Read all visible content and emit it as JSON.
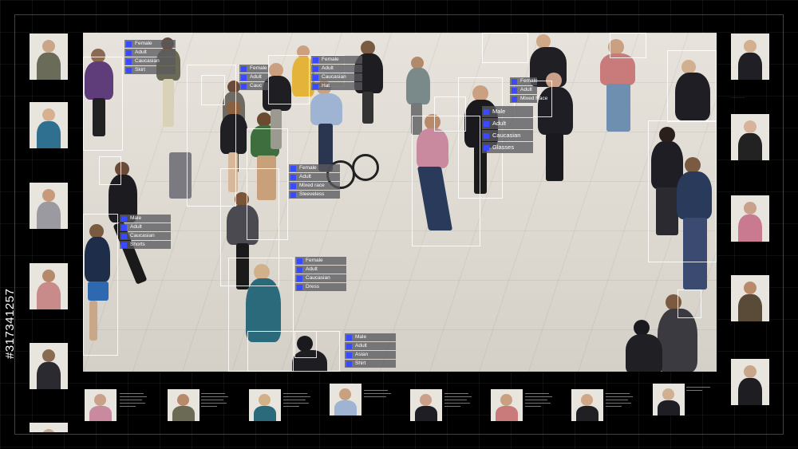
{
  "stock_id": "#317341257",
  "detections": [
    {
      "tags": [
        "Female",
        "Adult",
        "Caucasian",
        "Skirt"
      ]
    },
    {
      "tags": [
        "Female",
        "Adult",
        "Cauc"
      ]
    },
    {
      "tags": [
        "Female",
        "Adult",
        "Caucasian",
        "Hat"
      ]
    },
    {
      "tags": [
        "Female",
        "Adult",
        "Mixed race",
        "Sleeveless"
      ]
    },
    {
      "tags": [
        "Male",
        "Adult",
        "Caucasian",
        "Shorts"
      ]
    },
    {
      "tags": [
        "Female",
        "Adult",
        "Caucasian",
        "Dress"
      ]
    },
    {
      "tags": [
        "Male",
        "Adult",
        "Asian",
        "Shirt"
      ]
    },
    {
      "tags": [
        "Male",
        "Adult",
        "Caucasian",
        "Glasses"
      ]
    },
    {
      "tags": [
        "Female",
        "Adult",
        "Mixed Race"
      ]
    }
  ],
  "colors": {
    "accent": "#3a4bff",
    "frame": "#000000",
    "box": "#ffffff"
  }
}
